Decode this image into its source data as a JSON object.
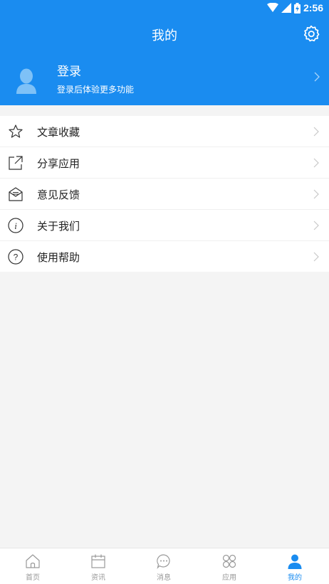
{
  "status_bar": {
    "time": "2:56"
  },
  "header": {
    "title": "我的"
  },
  "profile": {
    "login_title": "登录",
    "login_subtitle": "登录后体验更多功能"
  },
  "menu": {
    "items": [
      {
        "label": "文章收藏",
        "icon": "star-icon"
      },
      {
        "label": "分享应用",
        "icon": "share-icon"
      },
      {
        "label": "意见反馈",
        "icon": "feedback-icon"
      },
      {
        "label": "关于我们",
        "icon": "info-icon"
      },
      {
        "label": "使用帮助",
        "icon": "help-icon"
      }
    ]
  },
  "tabbar": {
    "tabs": [
      {
        "label": "首页",
        "icon": "home-icon"
      },
      {
        "label": "资讯",
        "icon": "calendar-icon"
      },
      {
        "label": "消息",
        "icon": "message-icon"
      },
      {
        "label": "应用",
        "icon": "apps-icon"
      },
      {
        "label": "我的",
        "icon": "user-icon",
        "active": true
      }
    ]
  },
  "colors": {
    "accent": "#1a8cf0",
    "background": "#f4f4f4"
  }
}
